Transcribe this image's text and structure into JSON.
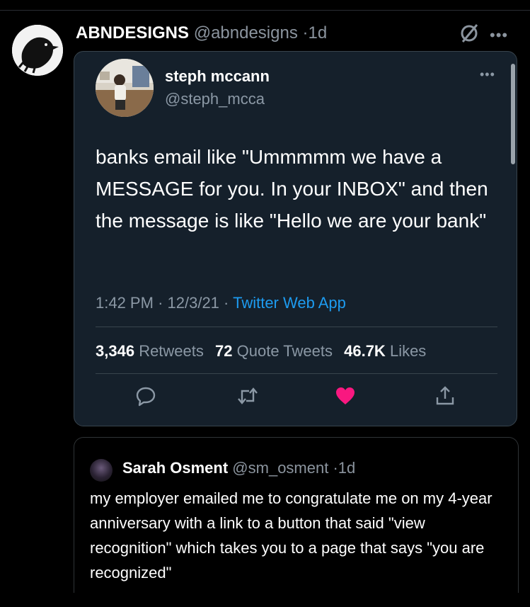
{
  "outer_tweet": {
    "display_name": "ABNDESIGNS",
    "handle": "@abndesigns",
    "separator": "·",
    "time_ago": "1d",
    "more_label": "•••"
  },
  "quoted_tweet": {
    "display_name": "steph mccann",
    "handle": "@steph_mcca",
    "more_label": "•••",
    "text": "banks email like \"Ummmmm we have a MESSAGE for you. In your INBOX\" and then the message is like \"Hello we are your bank\"",
    "time": "1:42 PM",
    "date": "12/3/21",
    "separator": "·",
    "source": "Twitter Web App",
    "stats": {
      "retweets_count": "3,346",
      "retweets_label": "Retweets",
      "quotes_count": "72",
      "quotes_label": "Quote Tweets",
      "likes_count": "46.7K",
      "likes_label": "Likes"
    },
    "liked": true,
    "like_color": "#f91880"
  },
  "reply_tweet": {
    "display_name": "Sarah Osment",
    "handle": "@sm_osment",
    "separator": "·",
    "time_ago": "1d",
    "text": "my employer emailed me to congratulate me on my 4-year anniversary with a link to a button that said \"view recognition\" which takes you to a page that says \"you are recognized\""
  },
  "colors": {
    "background": "#000000",
    "card_background": "#15202b",
    "muted_text": "#8b98a5",
    "link": "#1d9bf0"
  }
}
